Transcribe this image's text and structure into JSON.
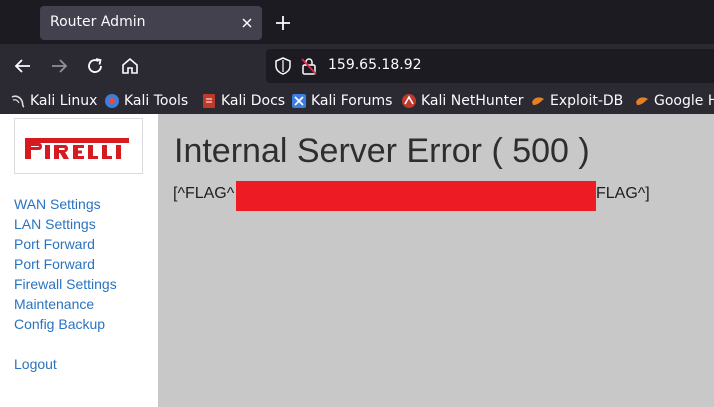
{
  "browser": {
    "tab": {
      "title": "Router Admin"
    },
    "url": "159.65.18.92",
    "bookmarks": [
      {
        "label": "Kali Linux",
        "icon": "kali-dragon-icon"
      },
      {
        "label": "Kali Tools",
        "icon": "kali-tools-icon"
      },
      {
        "label": "Kali Docs",
        "icon": "kali-docs-icon"
      },
      {
        "label": "Kali Forums",
        "icon": "kali-forums-icon"
      },
      {
        "label": "Kali NetHunter",
        "icon": "nethunter-icon"
      },
      {
        "label": "Exploit-DB",
        "icon": "exploit-db-icon"
      },
      {
        "label": "Google Hacking DB",
        "icon": "ghdb-icon"
      }
    ]
  },
  "sidebar": {
    "logo_text": "PIRELLI",
    "items": [
      {
        "label": "WAN Settings"
      },
      {
        "label": "LAN Settings"
      },
      {
        "label": "Port Forward"
      },
      {
        "label": "Port Forward"
      },
      {
        "label": "Firewall Settings"
      },
      {
        "label": "Maintenance"
      },
      {
        "label": "Config Backup"
      }
    ],
    "logout": "Logout"
  },
  "content": {
    "title": "Internal Server Error ( 500 )",
    "flag_prefix": "[^FLAG^",
    "flag_suffix": "FLAG^]"
  },
  "colors": {
    "link": "#2a73c0",
    "redaction": "#ed1c24",
    "page_bg": "#c8c8c8",
    "logo_red": "#d71920"
  }
}
